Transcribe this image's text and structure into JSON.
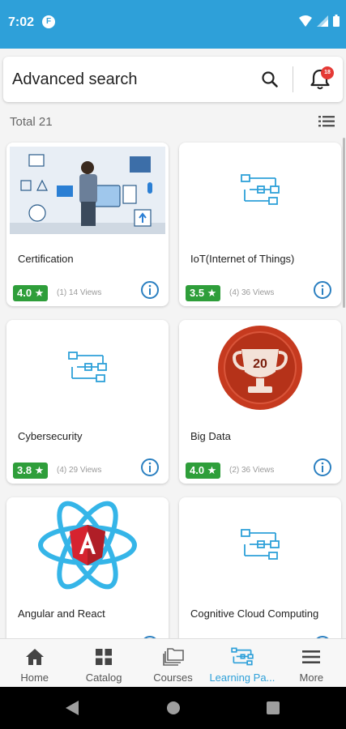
{
  "status_bar": {
    "time": "7:02",
    "app_icon_letter": "F"
  },
  "search": {
    "placeholder_text": "Advanced search",
    "notification_count": "18"
  },
  "summary": {
    "total": "Total 21"
  },
  "cards": [
    {
      "title": "Certification",
      "rating": "4.0 ★",
      "views": "(1) 14 Views"
    },
    {
      "title": "IoT(Internet of Things)",
      "rating": "3.5 ★",
      "views": "(4) 36 Views"
    },
    {
      "title": "Cybersecurity",
      "rating": "3.8 ★",
      "views": "(4) 29 Views"
    },
    {
      "title": "Big Data",
      "rating": "4.0 ★",
      "views": "(2) 36 Views",
      "trophy_number": "20"
    },
    {
      "title": "Angular and React",
      "rating": "",
      "views": ""
    },
    {
      "title": "Cognitive Cloud Computing",
      "rating": "",
      "views": ""
    }
  ],
  "bottom_nav": [
    {
      "label": "Home",
      "icon": "home-icon"
    },
    {
      "label": "Catalog",
      "icon": "grid-icon"
    },
    {
      "label": "Courses",
      "icon": "folders-icon"
    },
    {
      "label": "Learning Pa...",
      "icon": "learning-path-icon",
      "active": true
    },
    {
      "label": "More",
      "icon": "menu-icon"
    }
  ],
  "colors": {
    "accent": "#2ea0d9",
    "rating_green": "#2e9e3a",
    "badge_red": "#e53935"
  }
}
